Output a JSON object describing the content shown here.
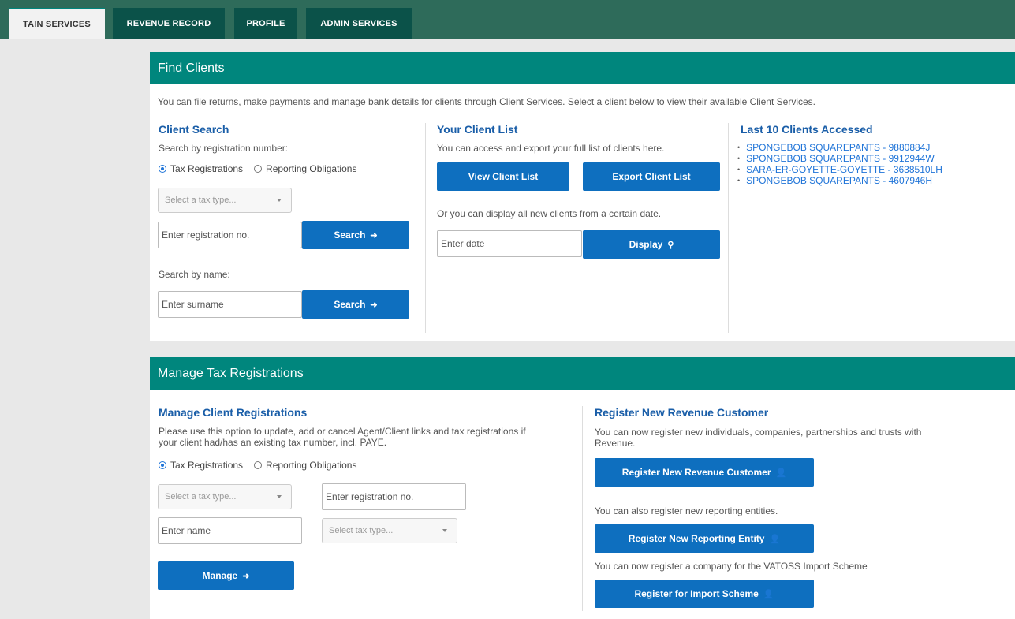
{
  "tabs": [
    {
      "label": "TAIN SERVICES"
    },
    {
      "label": "REVENUE RECORD"
    },
    {
      "label": "PROFILE"
    },
    {
      "label": "ADMIN SERVICES"
    }
  ],
  "find_clients": {
    "title": "Find Clients",
    "intro": "You can file returns, make payments and manage bank details for clients through Client Services. Select a client below to view their available Client Services.",
    "client_search": {
      "title": "Client Search",
      "by_reg_label": "Search by registration number:",
      "radio_tax": "Tax Registrations",
      "radio_reporting": "Reporting Obligations",
      "tax_type_placeholder": "Select a tax type...",
      "reg_no_placeholder": "Enter registration no.",
      "search_label": "Search",
      "by_name_label": "Search by name:",
      "surname_placeholder": "Enter surname",
      "search_label2": "Search"
    },
    "client_list": {
      "title": "Your Client List",
      "desc": "You can access and export your full list of clients here.",
      "view_label": "View Client List",
      "export_label": "Export Client List",
      "date_desc": "Or you can display all new clients from a certain date.",
      "date_placeholder": "Enter date",
      "display_label": "Display"
    },
    "last_clients": {
      "title": "Last 10 Clients Accessed",
      "items": [
        "SPONGEBOB SQUAREPANTS - 9880884J",
        "SPONGEBOB SQUAREPANTS - 9912944W",
        "SARA-ER-GOYETTE-GOYETTE - 3638510LH",
        "SPONGEBOB SQUAREPANTS - 4607946H"
      ]
    }
  },
  "manage": {
    "title": "Manage Tax Registrations",
    "client_reg": {
      "title": "Manage Client Registrations",
      "desc1": "Please use this option to update, add or cancel Agent/Client links and tax registrations if",
      "desc2": "your client had/has an existing tax number, incl. PAYE.",
      "radio_tax": "Tax Registrations",
      "radio_reporting": "Reporting Obligations",
      "tax_type_placeholder": "Select a tax type...",
      "reg_no_placeholder": "Enter registration no.",
      "name_placeholder": "Enter name",
      "tax_type2_placeholder": "Select tax type...",
      "manage_label": "Manage"
    },
    "register_new": {
      "title": "Register New Revenue Customer",
      "desc1": "You can now register new individuals, companies, partnerships and trusts with",
      "desc2": "Revenue.",
      "register_customer_label": "Register New Revenue Customer",
      "entities_desc": "You can also register new reporting entities.",
      "register_entity_label": "Register New Reporting Entity",
      "vatoss_desc": "You can now register a company for the VATOSS Import Scheme",
      "import_label": "Register for Import Scheme"
    }
  }
}
